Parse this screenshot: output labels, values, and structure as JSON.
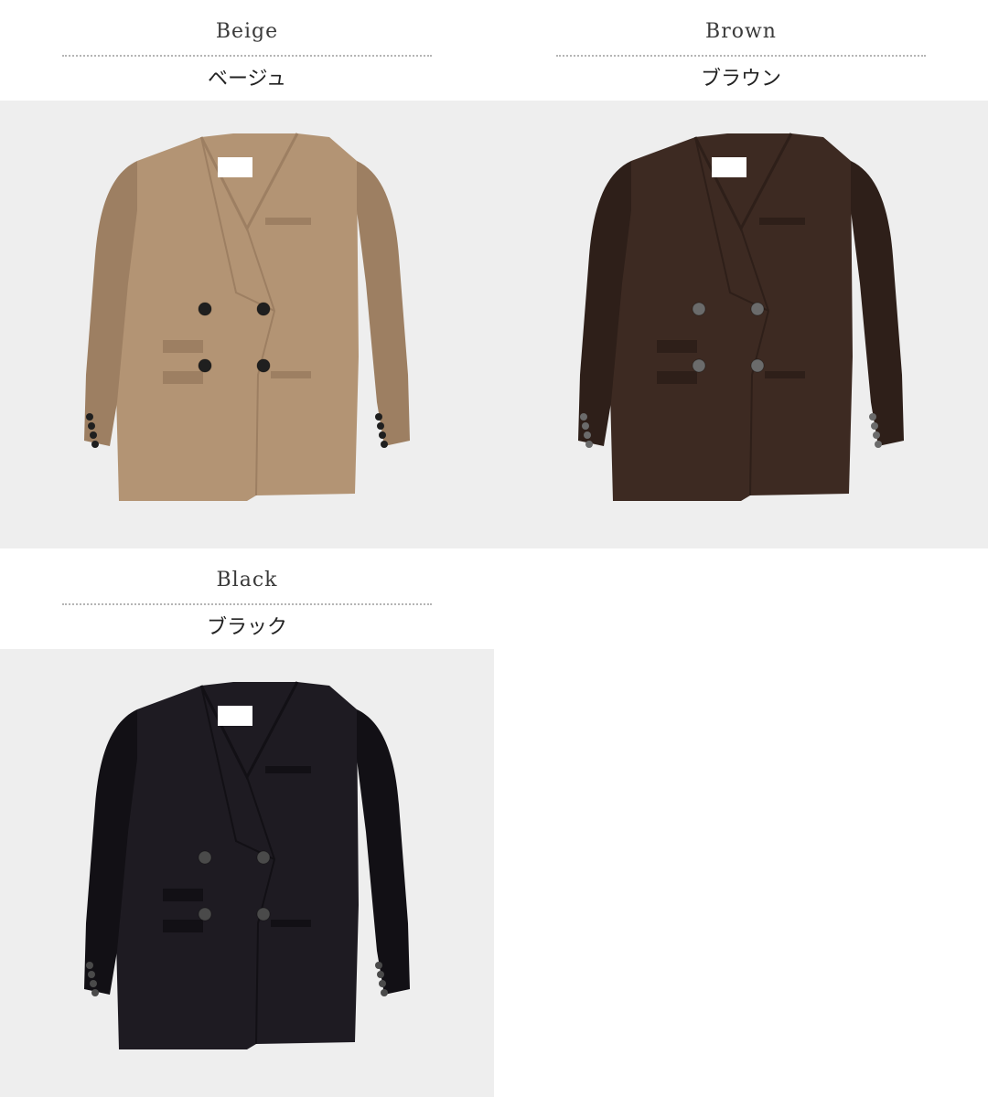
{
  "variants": [
    {
      "name_en": "Beige",
      "name_jp": "ベージュ",
      "color_fabric": "#b39474",
      "color_shadow": "#9d7f62",
      "color_button": "#1f1f1f",
      "image": "beige-jacket-photo"
    },
    {
      "name_en": "Brown",
      "name_jp": "ブラウン",
      "color_fabric": "#3d2a22",
      "color_shadow": "#2e1f19",
      "color_button": "#6b6b6b",
      "image": "brown-jacket-photo"
    },
    {
      "name_en": "Black",
      "name_jp": "ブラック",
      "color_fabric": "#1e1b22",
      "color_shadow": "#121015",
      "color_button": "#4a4a4a",
      "image": "black-jacket-photo"
    }
  ],
  "colors": {
    "photo_background": "#eeeeee",
    "separator": "#b5b5b5"
  }
}
